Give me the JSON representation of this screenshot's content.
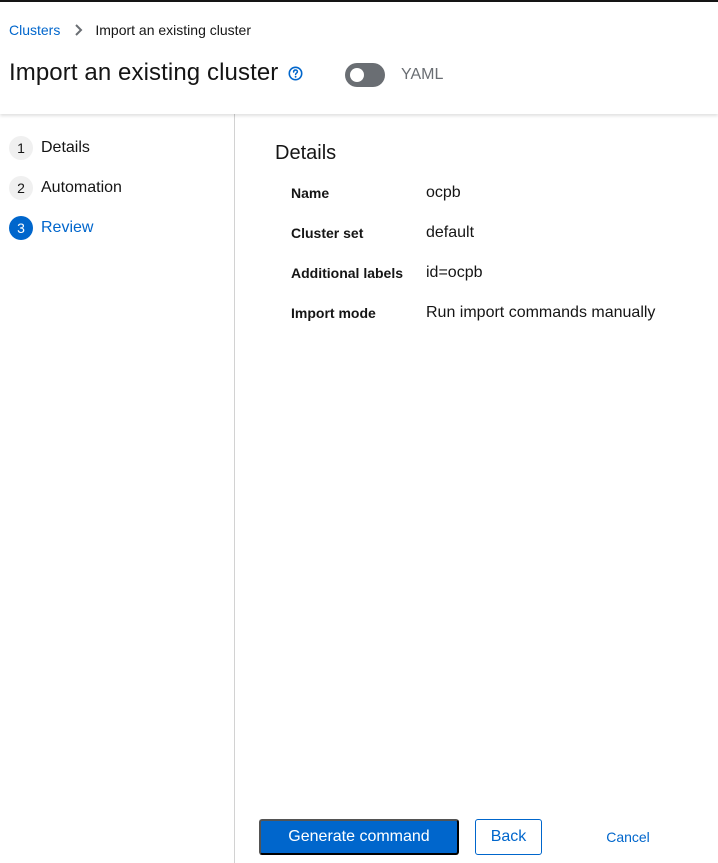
{
  "breadcrumb": {
    "parent": "Clusters",
    "current": "Import an existing cluster"
  },
  "header": {
    "title": "Import an existing cluster",
    "yaml_label": "YAML"
  },
  "steps": [
    {
      "number": "1",
      "label": "Details"
    },
    {
      "number": "2",
      "label": "Automation"
    },
    {
      "number": "3",
      "label": "Review"
    }
  ],
  "review": {
    "section_title": "Details",
    "rows": [
      {
        "term": "Name",
        "value": "ocpb"
      },
      {
        "term": "Cluster set",
        "value": "default"
      },
      {
        "term": "Additional labels",
        "value": "id=ocpb"
      },
      {
        "term": "Import mode",
        "value": "Run import commands manually"
      }
    ]
  },
  "footer": {
    "primary_label": "Generate command",
    "back_label": "Back",
    "cancel_label": "Cancel"
  },
  "colors": {
    "accent": "#0066cc",
    "toggle_off": "#6a6e73",
    "nav_step_bg": "#f0f0f0"
  },
  "icons": {
    "breadcrumb_separator": "chevron-right-icon",
    "help": "help-circle-icon"
  },
  "state": {
    "yaml_toggle_on": false,
    "active_step": 3
  }
}
